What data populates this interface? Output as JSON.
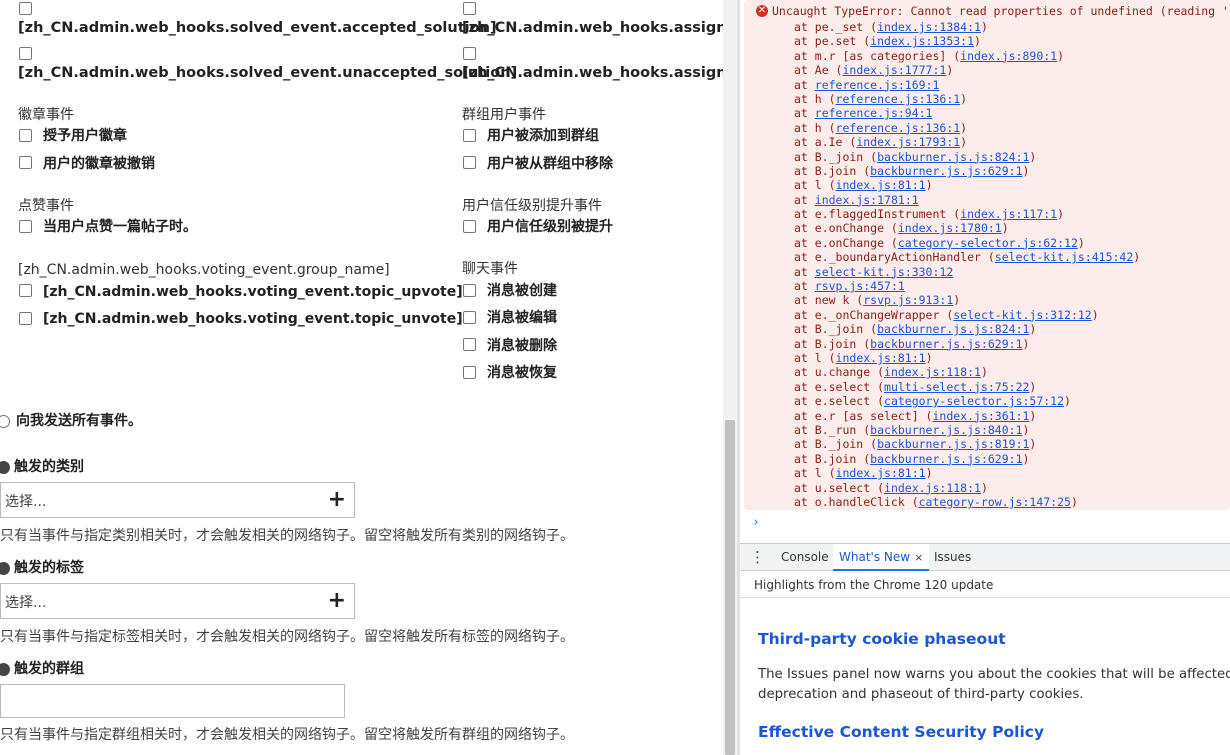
{
  "webhook_form": {
    "solved_accepted": "[zh_CN.admin.web_hooks.solved_event.accepted_solution]",
    "solved_unaccepted": "[zh_CN.admin.web_hooks.solved_event.unaccepted_solution]",
    "assign_event_1": "[zh_CN.admin.web_hooks.assign_ev",
    "assign_event_2": "[zh_CN.admin.web_hooks.assign_ev",
    "badge_group": "徽章事件",
    "badge_granted": "授予用户徽章",
    "badge_revoked": "用户的徽章被撤销",
    "group_user_group": "群组用户事件",
    "group_user_added": "用户被添加到群组",
    "group_user_removed": "用户被从群组中移除",
    "like_group": "点赞事件",
    "like_post": "当用户点赞一篇帖子时。",
    "trust_group": "用户信任级别提升事件",
    "trust_up": "用户信任级别被提升",
    "voting_group": "[zh_CN.admin.web_hooks.voting_event.group_name]",
    "voting_upvote": "[zh_CN.admin.web_hooks.voting_event.topic_upvote]",
    "voting_unvote": "[zh_CN.admin.web_hooks.voting_event.topic_unvote]",
    "chat_group": "聊天事件",
    "chat_created": "消息被创建",
    "chat_edited": "消息被编辑",
    "chat_deleted": "消息被删除",
    "chat_restored": "消息被恢复",
    "send_all": "向我发送所有事件。",
    "trigger_categories_label": "触发的类别",
    "trigger_categories_placeholder": "选择...",
    "trigger_categories_help": "只有当事件与指定类别相关时，才会触发相关的网络钩子。留空将触发所有类别的网络钩子。",
    "trigger_tags_label": "触发的标签",
    "trigger_tags_placeholder": "选择...",
    "trigger_tags_help": "只有当事件与指定标签相关时，才会触发相关的网络钩子。留空将触发所有标签的网络钩子。",
    "trigger_groups_label": "触发的群组",
    "trigger_groups_help": "只有当事件与指定群组相关时，才会触发相关的网络钩子。留空将触发所有群组的网络钩子。"
  },
  "devtools": {
    "error_icon": "x-circle-icon",
    "error_message": "Uncaught TypeError: Cannot read properties of undefined (reading 'call",
    "stack": [
      {
        "pre": "at pe._set (",
        "link": "index.js:1384:1",
        "post": ")"
      },
      {
        "pre": "at pe.set (",
        "link": "index.js:1353:1",
        "post": ")"
      },
      {
        "pre": "at m.r [as categories] (",
        "link": "index.js:890:1",
        "post": ")"
      },
      {
        "pre": "at Ae (",
        "link": "index.js:1777:1",
        "post": ")"
      },
      {
        "pre": "at ",
        "link": "reference.js:169:1",
        "post": ""
      },
      {
        "pre": "at h (",
        "link": "reference.js:136:1",
        "post": ")"
      },
      {
        "pre": "at ",
        "link": "reference.js:94:1",
        "post": ""
      },
      {
        "pre": "at h (",
        "link": "reference.js:136:1",
        "post": ")"
      },
      {
        "pre": "at a.Ie (",
        "link": "index.js:1793:1",
        "post": ")"
      },
      {
        "pre": "at B._join (",
        "link": "backburner.js.js:824:1",
        "post": ")"
      },
      {
        "pre": "at B.join (",
        "link": "backburner.js.js:629:1",
        "post": ")"
      },
      {
        "pre": "at l (",
        "link": "index.js:81:1",
        "post": ")"
      },
      {
        "pre": "at ",
        "link": "index.js:1781:1",
        "post": ""
      },
      {
        "pre": "at e.flaggedInstrument (",
        "link": "index.js:117:1",
        "post": ")"
      },
      {
        "pre": "at e.onChange (",
        "link": "index.js:1780:1",
        "post": ")"
      },
      {
        "pre": "at e.onChange (",
        "link": "category-selector.js:62:12",
        "post": ")"
      },
      {
        "pre": "at e._boundaryActionHandler (",
        "link": "select-kit.js:415:42",
        "post": ")"
      },
      {
        "pre": "at ",
        "link": "select-kit.js:330:12",
        "post": ""
      },
      {
        "pre": "at ",
        "link": "rsvp.js:457:1",
        "post": ""
      },
      {
        "pre": "at new k (",
        "link": "rsvp.js:913:1",
        "post": ")"
      },
      {
        "pre": "at e._onChangeWrapper (",
        "link": "select-kit.js:312:12",
        "post": ")"
      },
      {
        "pre": "at B._join (",
        "link": "backburner.js.js:824:1",
        "post": ")"
      },
      {
        "pre": "at B.join (",
        "link": "backburner.js.js:629:1",
        "post": ")"
      },
      {
        "pre": "at l (",
        "link": "index.js:81:1",
        "post": ")"
      },
      {
        "pre": "at u.change (",
        "link": "index.js:118:1",
        "post": ")"
      },
      {
        "pre": "at e.select (",
        "link": "multi-select.js:75:22",
        "post": ")"
      },
      {
        "pre": "at e.select (",
        "link": "category-selector.js:57:12",
        "post": ")"
      },
      {
        "pre": "at e.r [as select] (",
        "link": "index.js:361:1",
        "post": ")"
      },
      {
        "pre": "at B._run (",
        "link": "backburner.js.js:840:1",
        "post": ")"
      },
      {
        "pre": "at B._join (",
        "link": "backburner.js.js:819:1",
        "post": ")"
      },
      {
        "pre": "at B.join (",
        "link": "backburner.js.js:629:1",
        "post": ")"
      },
      {
        "pre": "at l (",
        "link": "index.js:81:1",
        "post": ")"
      },
      {
        "pre": "at u.select (",
        "link": "index.js:118:1",
        "post": ")"
      },
      {
        "pre": "at o.handleClick (",
        "link": "category-row.js:147:25",
        "post": ")"
      }
    ],
    "prompt": "›",
    "drawer_menu_icon": "kebab-menu-icon",
    "tab_console": "Console",
    "tab_whats_new": "What's New",
    "tab_whats_new_close": "×",
    "tab_issues": "Issues",
    "whats_new_subtitle": "Highlights from the Chrome 120 update",
    "article1_title": "Third-party cookie phaseout",
    "article1_body_line1": "The Issues panel now warns you about the cookies that will be affected by th",
    "article1_body_line2": "deprecation and phaseout of third-party cookies.",
    "article2_title": "Effective Content Security Policy"
  }
}
